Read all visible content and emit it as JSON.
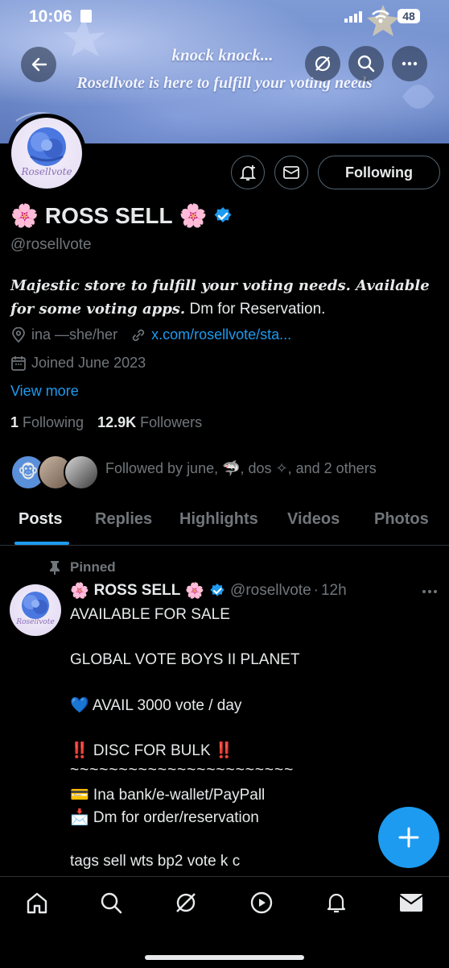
{
  "status_bar": {
    "time": "10:06",
    "battery": "48"
  },
  "banner": {
    "line1": "knock knock...",
    "line2": "Rosellvote is here to fulfill your voting needs"
  },
  "profile": {
    "avatar_text": "Rosellvote",
    "name": "ROSS SELL",
    "name_emoji": "🌸",
    "handle": "@rosellvote",
    "bio_italic": "Majestic store to fulfill your voting needs. Available for some voting apps.",
    "bio_plain": " Dm for Reservation.",
    "location": "ina —she/her",
    "website": "x.com/rosellvote/sta...",
    "joined": "Joined June 2023",
    "view_more": "View more",
    "following_count": "1",
    "following_label": "Following",
    "followers_count": "12.9K",
    "followers_label": "Followers",
    "followed_by": "Followed by",
    "followed_by_names": "june, 🦈, dos ✧, and 2 others"
  },
  "actions": {
    "following_button": "Following"
  },
  "tabs": [
    "Posts",
    "Replies",
    "Highlights",
    "Videos",
    "Photos"
  ],
  "pinned_post": {
    "pinned_label": "Pinned",
    "author_name": "ROSS SELL",
    "handle": "@rosellvote",
    "time": "12h",
    "lines": [
      "AVAILABLE FOR SALE",
      "GLOBAL VOTE  BOYS II PLANET",
      "💙 AVAIL 3000 vote / day",
      "‼️ DISC FOR BULK ‼️",
      "~~~~~~~~~~~~~~~~~~~~~~~",
      "💳 Ina bank/e-wallet/PayPall",
      "📩 Dm for order/reservation",
      "tags sell wts bp2 vote k c"
    ]
  },
  "colors": {
    "accent": "#1d9bf0",
    "background": "#000000",
    "muted": "#71767b"
  },
  "icons": [
    "back-arrow-icon",
    "grok-icon",
    "search-icon",
    "more-icon",
    "add-notification-icon",
    "mail-icon",
    "verified-icon",
    "location-icon",
    "link-icon",
    "calendar-icon",
    "pin-icon",
    "home-icon",
    "compose-icon",
    "video-icon",
    "bell-icon",
    "messages-icon"
  ]
}
